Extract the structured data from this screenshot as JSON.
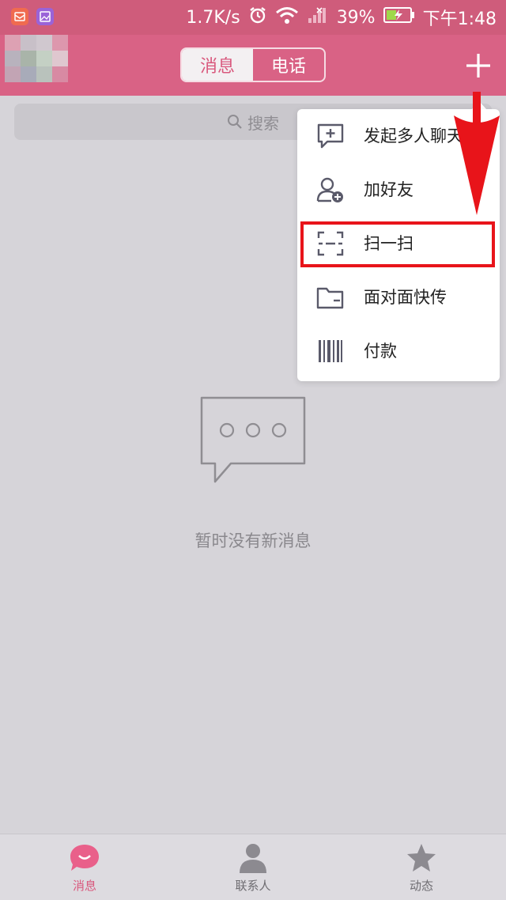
{
  "statusbar": {
    "network_speed": "1.7K/s",
    "battery": "39%",
    "time": "下午1:48"
  },
  "header": {
    "tabs": [
      {
        "label": "消息",
        "active": true
      },
      {
        "label": "电话",
        "active": false
      }
    ]
  },
  "search": {
    "placeholder": "搜索"
  },
  "menu": {
    "items": [
      {
        "label": "发起多人聊天",
        "icon": "group-chat-icon"
      },
      {
        "label": "加好友",
        "icon": "add-friend-icon"
      },
      {
        "label": "扫一扫",
        "icon": "scan-icon"
      },
      {
        "label": "面对面快传",
        "icon": "folder-transfer-icon"
      },
      {
        "label": "付款",
        "icon": "barcode-icon"
      }
    ],
    "highlighted_item": "扫一扫"
  },
  "empty_state": {
    "message": "暂时没有新消息",
    "icon": "chat-bubble-icon"
  },
  "bottom_nav": {
    "items": [
      {
        "label": "消息",
        "icon": "message-icon",
        "active": true
      },
      {
        "label": "联系人",
        "icon": "contacts-icon",
        "active": false
      },
      {
        "label": "动态",
        "icon": "star-icon",
        "active": false
      }
    ]
  },
  "colors": {
    "header": "#d96285",
    "accent": "#d9587d",
    "highlight": "#e8141a",
    "background": "#d6d4d9"
  }
}
